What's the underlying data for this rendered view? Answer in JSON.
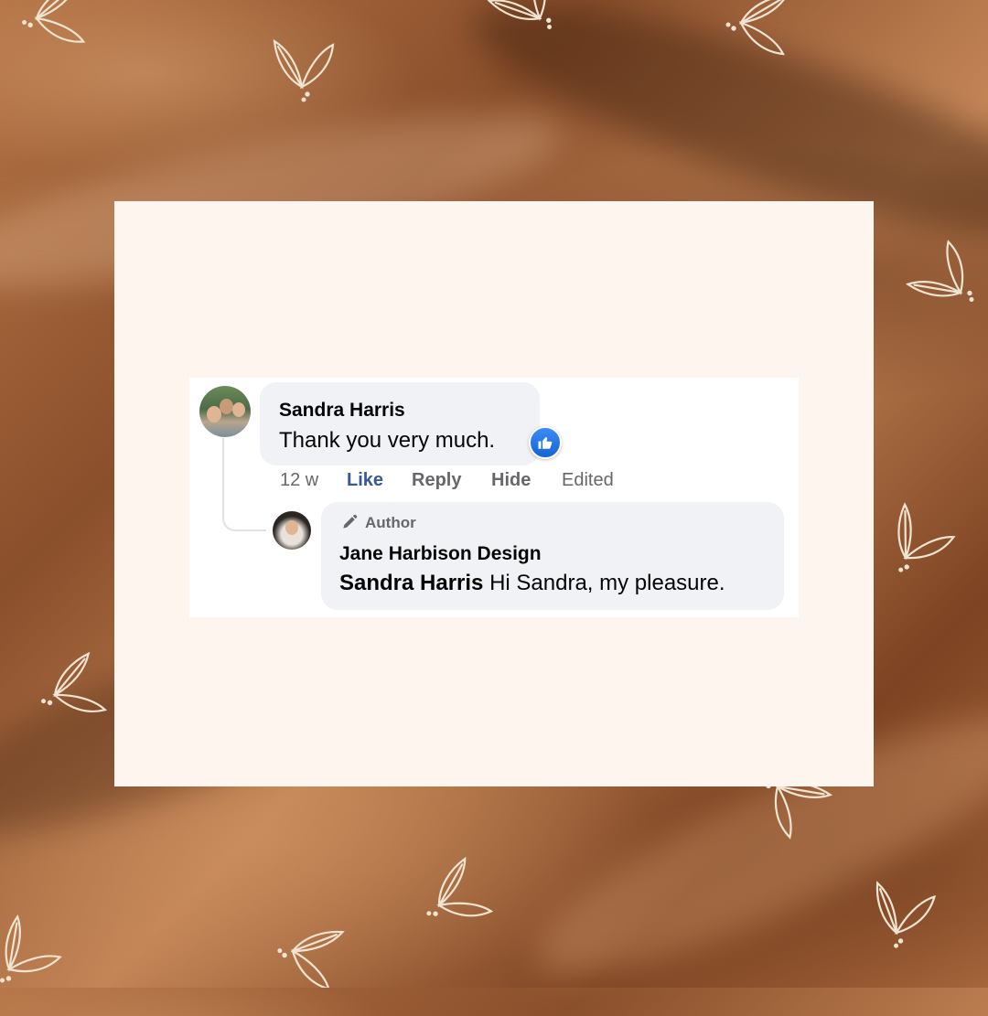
{
  "colors": {
    "background": "#9a5c33",
    "card": "#fdf5ee",
    "bubble": "#f0f2f5",
    "like_blue": "#385898",
    "meta_gray": "#65676b"
  },
  "comment": {
    "author": "Sandra Harris",
    "text": "Thank you very much.",
    "reaction_icon": "thumbs-up-icon",
    "time": "12 w",
    "actions": {
      "like": "Like",
      "reply": "Reply",
      "hide": "Hide"
    },
    "edited": "Edited"
  },
  "reply": {
    "badge_icon": "pen-icon",
    "badge": "Author",
    "author": "Jane Harbison Design",
    "mention": "Sandra Harris",
    "text": "Hi Sandra, my pleasure."
  }
}
